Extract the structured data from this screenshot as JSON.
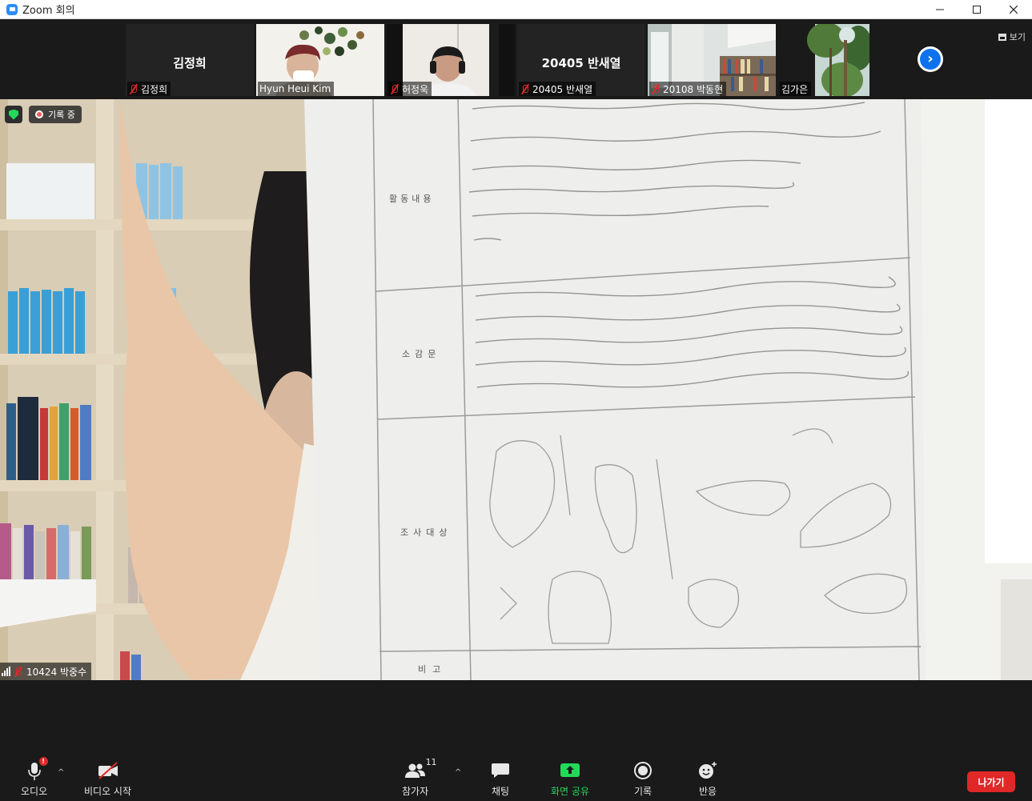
{
  "window": {
    "title": "Zoom 회의",
    "minimize": "—",
    "maximize": "☐",
    "close": "✕"
  },
  "gallery": {
    "participants": [
      {
        "big_name": "김정희",
        "name": "김정희",
        "muted": true,
        "video": false
      },
      {
        "big_name": "",
        "name": "Hyun Heui Kim",
        "muted": false,
        "video": true
      },
      {
        "big_name": "",
        "name": "허정욱",
        "muted": true,
        "video": true
      },
      {
        "big_name": "20405 반새열",
        "name": "20405 반새열",
        "muted": true,
        "video": false
      },
      {
        "big_name": "",
        "name": "20108 박동현",
        "muted": true,
        "video": true
      },
      {
        "big_name": "",
        "name": "김가은",
        "muted": false,
        "video": true
      }
    ],
    "view_label": "보기",
    "next_glyph": "›"
  },
  "main": {
    "recording_label": "기록 중",
    "speaker_name": "10424 박중수",
    "worksheet": {
      "row1_label": "활동내용",
      "row2_label": "소감문",
      "row3_label": "조사대상",
      "row4_label": "비고"
    }
  },
  "toolbar": {
    "audio_label": "오디오",
    "video_label": "비디오 시작",
    "participants_label": "참가자",
    "participants_count": "11",
    "chat_label": "채팅",
    "share_label": "화면 공유",
    "record_label": "기록",
    "reactions_label": "반응",
    "leave_label": "나가기",
    "caret": "^",
    "alert_glyph": "!"
  },
  "colors": {
    "accent_blue": "#0e72ed",
    "share_green": "#23d959",
    "leave_red": "#e02828",
    "background": "#1a1a1a"
  }
}
